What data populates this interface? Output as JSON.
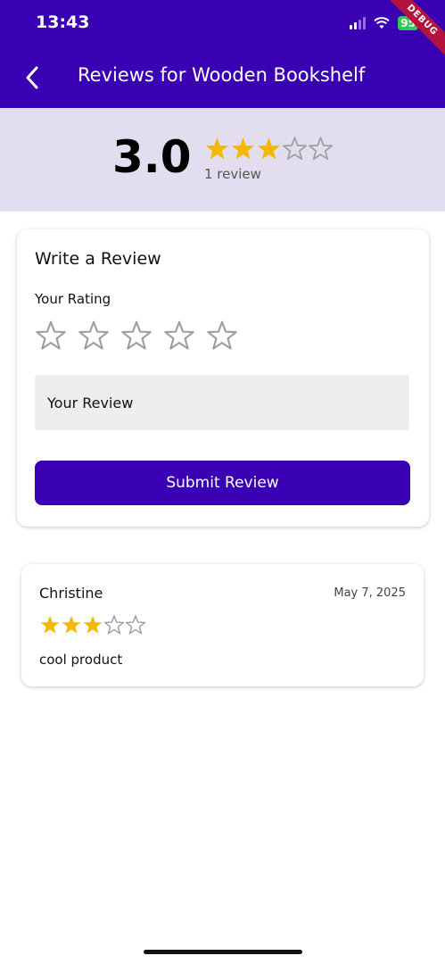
{
  "status_bar": {
    "time": "13:43",
    "battery": "95",
    "debug_label": "DEBUG"
  },
  "app_bar": {
    "title": "Reviews for Wooden Bookshelf"
  },
  "summary": {
    "average": "3.0",
    "rating": 3,
    "count_text": "1 review"
  },
  "write_review": {
    "title": "Write a Review",
    "rating_label": "Your Rating",
    "selected_rating": 0,
    "review_placeholder": "Your Review",
    "review_value": "",
    "submit_label": "Submit Review"
  },
  "reviews": [
    {
      "name": "Christine",
      "date": "May 7, 2025",
      "rating": 3,
      "text": "cool product"
    }
  ],
  "colors": {
    "primary": "#3a00b4",
    "star_filled": "#f5b800",
    "star_empty": "#9e9e9e",
    "summary_bg": "#e2def0"
  }
}
